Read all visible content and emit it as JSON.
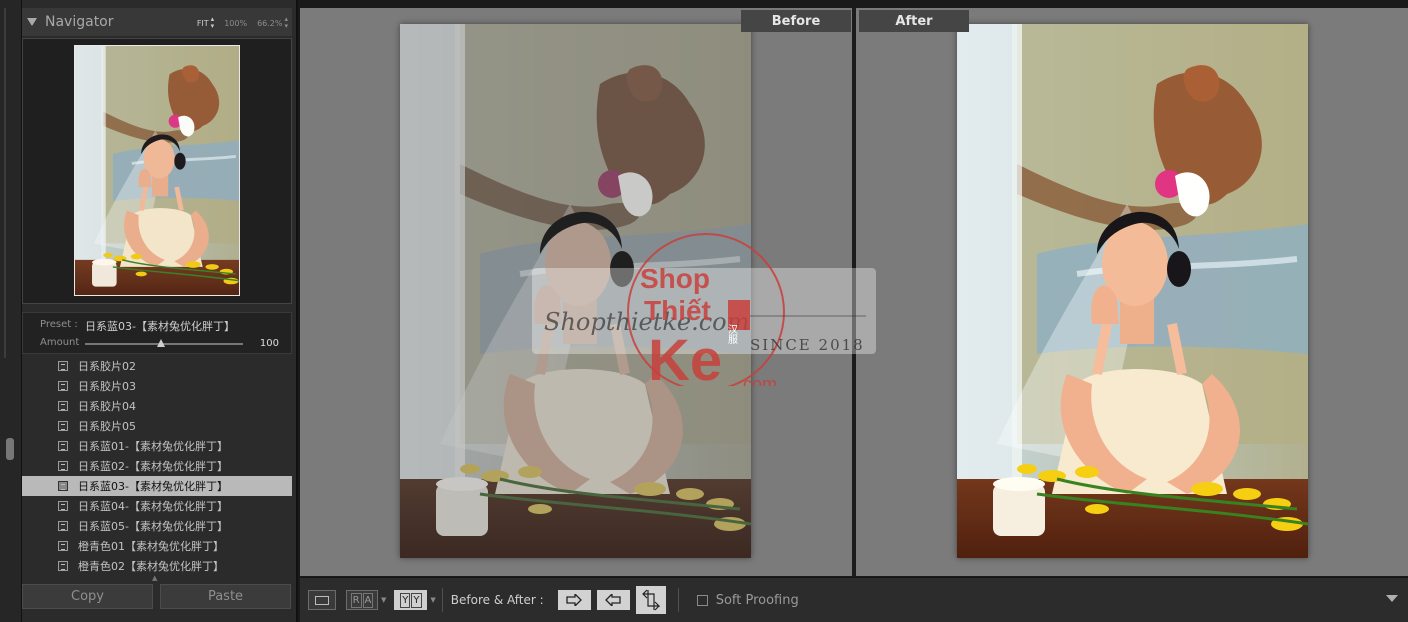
{
  "navigator": {
    "title": "Navigator",
    "zoom_fit": "FIT",
    "zoom_100": "100%",
    "zoom_custom": "66.2%"
  },
  "preset": {
    "label": "Preset :",
    "name": "日系蓝03-【素材兔优化胖丁】",
    "amount_label": "Amount",
    "amount_value": "100",
    "amount_fraction": 0.48
  },
  "preset_list": [
    {
      "label": "日系胶片02",
      "selected": false
    },
    {
      "label": "日系胶片03",
      "selected": false
    },
    {
      "label": "日系胶片04",
      "selected": false
    },
    {
      "label": "日系胶片05",
      "selected": false
    },
    {
      "label": "日系蓝01-【素材兔优化胖丁】",
      "selected": false
    },
    {
      "label": "日系蓝02-【素材兔优化胖丁】",
      "selected": false
    },
    {
      "label": "日系蓝03-【素材兔优化胖丁】",
      "selected": true
    },
    {
      "label": "日系蓝04-【素材兔优化胖丁】",
      "selected": false
    },
    {
      "label": "日系蓝05-【素材兔优化胖丁】",
      "selected": false
    },
    {
      "label": "橙青色01【素材兔优化胖丁】",
      "selected": false
    },
    {
      "label": "橙青色02【素材兔优化胖丁】",
      "selected": false
    }
  ],
  "buttons": {
    "copy": "Copy",
    "paste": "Paste"
  },
  "view": {
    "before_label": "Before",
    "after_label": "After"
  },
  "watermark": {
    "script": "Shopthietke.com",
    "since": "SINCE 2018",
    "shop": "Shop",
    "thiet": "Thiết",
    "ke": "Ke",
    "com": ".com",
    "badge": "汉服"
  },
  "toolbar": {
    "ra_r": "R",
    "ra_a": "A",
    "yy_left": "Y",
    "yy_right": "Y",
    "before_after_label": "Before & After :",
    "soft_proofing": "Soft Proofing"
  },
  "icons": {
    "swap_right": "arrow-right-icon",
    "swap_left": "arrow-left-icon",
    "swap_vertical": "swap-vertical-icon"
  },
  "colors": {
    "selected_row": "#b9b9b9",
    "watermark_red": "#c8403c",
    "pane_bg": "#7b7b7b"
  }
}
